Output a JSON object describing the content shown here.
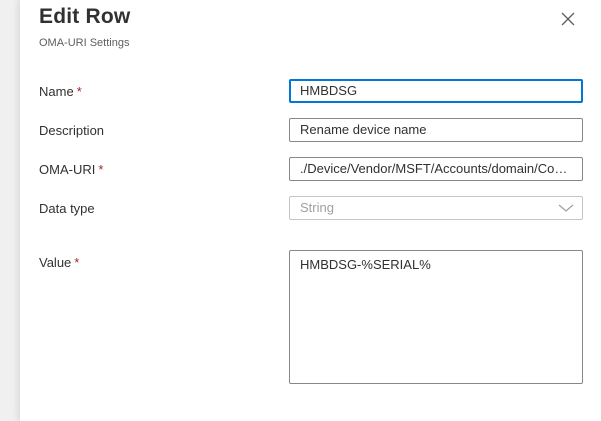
{
  "panel": {
    "title": "Edit Row",
    "subtitle": "OMA-URI Settings",
    "close_icon": "close-icon"
  },
  "form": {
    "required_marker": "*",
    "name": {
      "label": "Name",
      "value": "HMBDSG",
      "required": true
    },
    "description": {
      "label": "Description",
      "value": "Rename device name",
      "required": false
    },
    "oma_uri": {
      "label": "OMA-URI",
      "value": "./Device/Vendor/MSFT/Accounts/domain/Com...",
      "required": true
    },
    "data_type": {
      "label": "Data type",
      "value": "String",
      "required": false,
      "disabled": true
    },
    "value": {
      "label": "Value",
      "value": "HMBDSG-%SERIAL%",
      "required": true
    }
  },
  "colors": {
    "accent": "#0078d4",
    "required": "#a4262c",
    "text": "#323130",
    "muted": "#605e5c"
  }
}
